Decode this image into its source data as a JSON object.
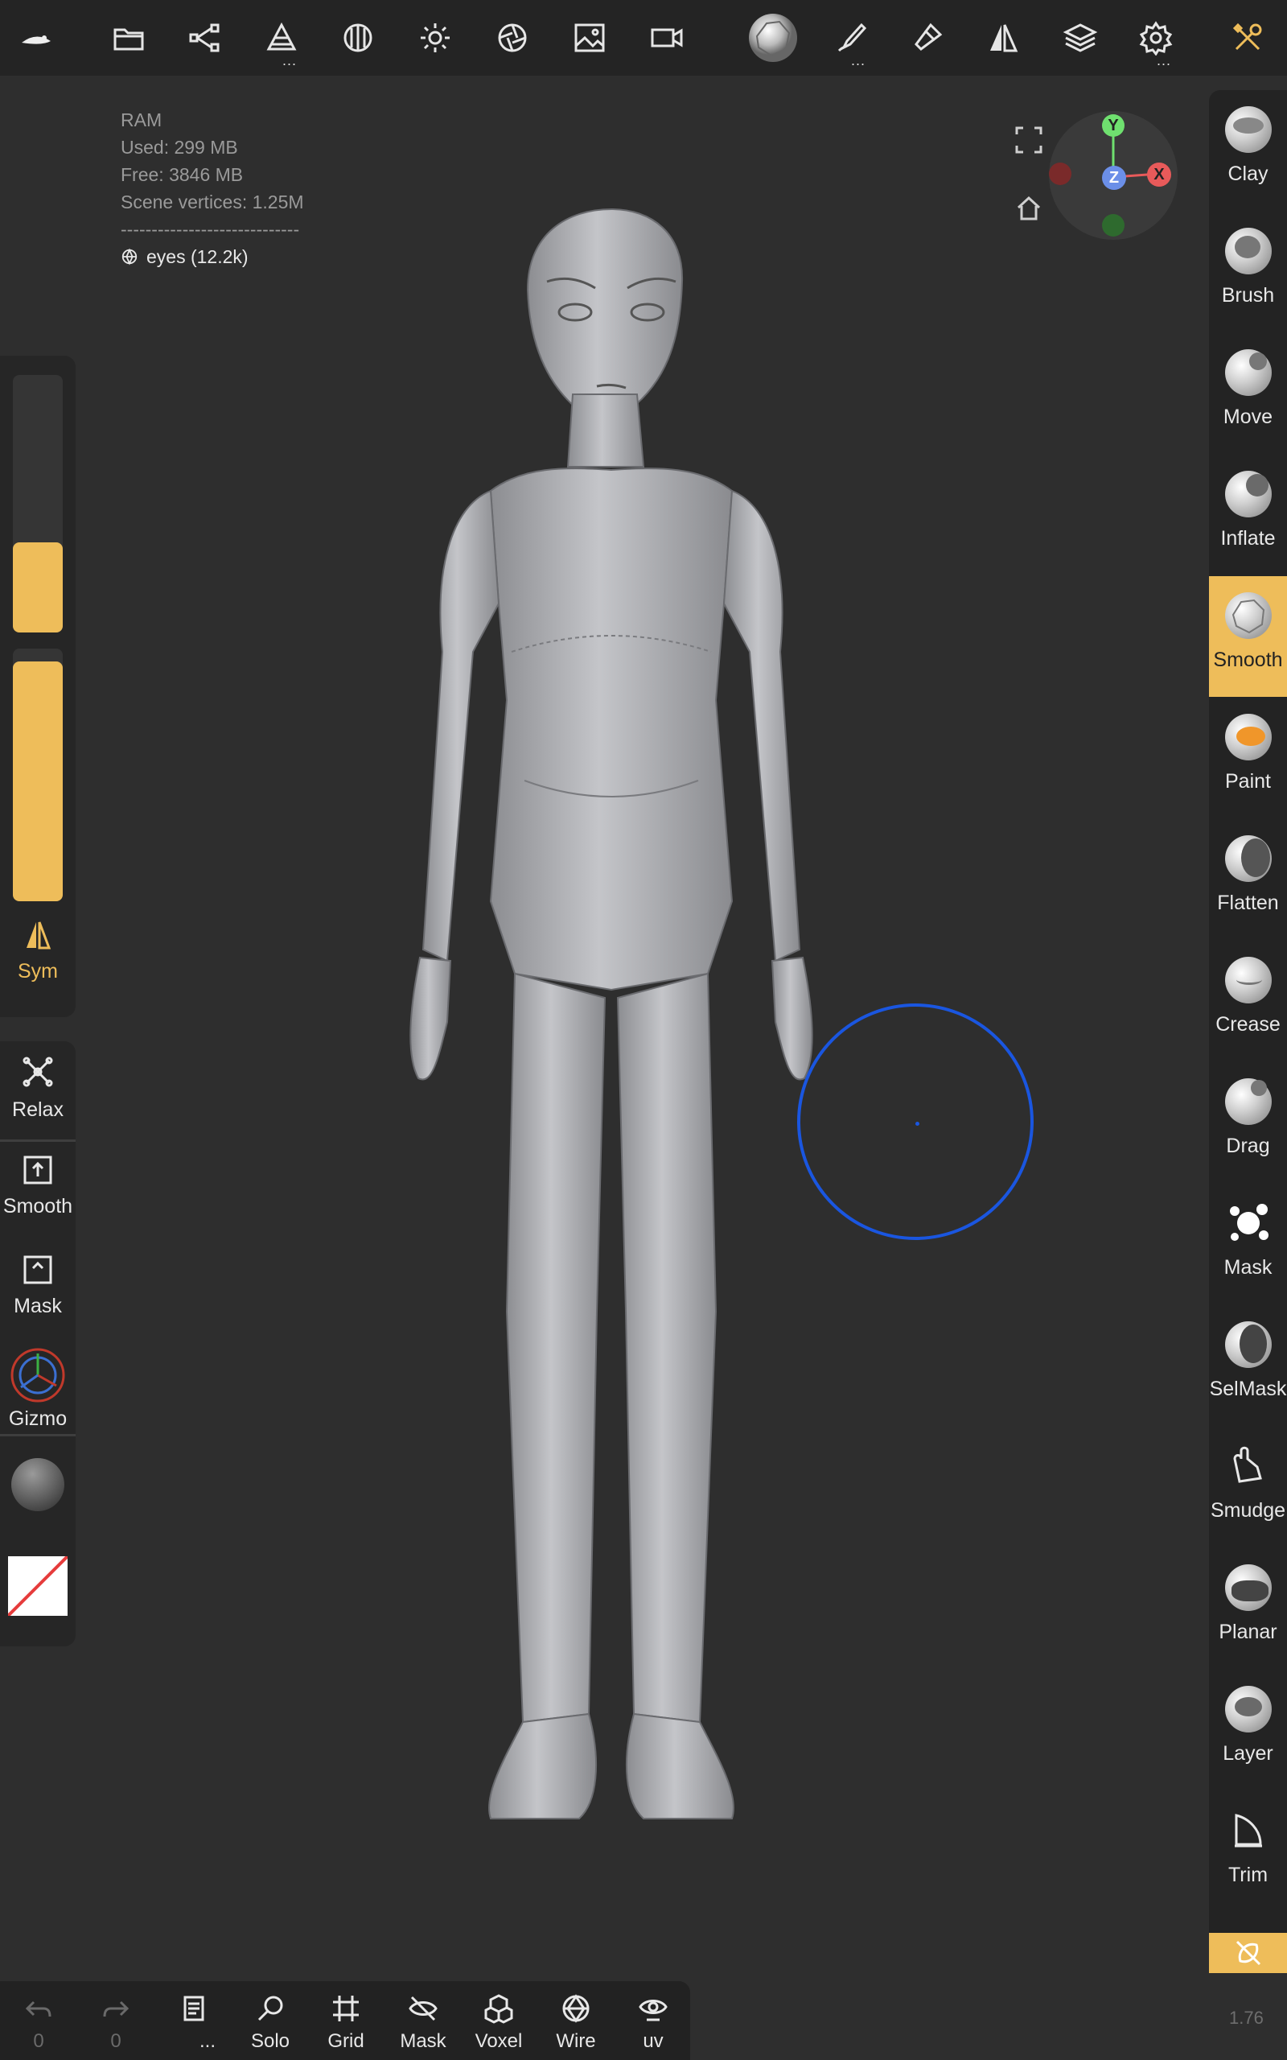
{
  "topbar": {
    "icons": [
      "logo-icon",
      "folder-icon",
      "scene-graph-icon",
      "primitives-icon",
      "material-sphere-icon",
      "light-icon",
      "camera-aperture-icon",
      "background-image-icon",
      "video-icon",
      "smooth-brush-ball-icon",
      "brush-settings-icon",
      "paint-brush-icon",
      "symmetry-icon",
      "layers-icon",
      "settings-icon",
      "tools-icon"
    ],
    "more_label": "..."
  },
  "ram": {
    "title": "RAM",
    "used": "Used: 299 MB",
    "free": "Free: 3846 MB",
    "vertices": "Scene vertices: 1.25M",
    "separator": "-----------------------------",
    "mesh": "eyes (12.2k)"
  },
  "left_panel": {
    "radius_level": 0.35,
    "intensity_level": 0.95,
    "sym_label": "Sym",
    "relax_label": "Relax",
    "smooth_label": "Smooth",
    "mask_label": "Mask",
    "gizmo_label": "Gizmo"
  },
  "tools": [
    {
      "label": "Clay"
    },
    {
      "label": "Brush"
    },
    {
      "label": "Move"
    },
    {
      "label": "Inflate"
    },
    {
      "label": "Smooth",
      "active": true
    },
    {
      "label": "Paint"
    },
    {
      "label": "Flatten"
    },
    {
      "label": "Crease"
    },
    {
      "label": "Drag"
    },
    {
      "label": "Mask"
    },
    {
      "label": "SelMask"
    },
    {
      "label": "Smudge"
    },
    {
      "label": "Planar"
    },
    {
      "label": "Layer"
    },
    {
      "label": "Trim"
    }
  ],
  "gizmo": {
    "y": "Y",
    "z": "Z",
    "x": "X",
    "colors": {
      "y": "#6fe06f",
      "x": "#e85a5a",
      "z": "#6b8fe8"
    }
  },
  "bottombar": {
    "undo_count": "0",
    "redo_count": "0",
    "more_label": "...",
    "solo_label": "Solo",
    "grid_label": "Grid",
    "mask_label": "Mask",
    "voxel_label": "Voxel",
    "wire_label": "Wire",
    "uv_label": "uv"
  },
  "version": "1.76",
  "colors": {
    "accent": "#eebd5a",
    "brush_circle": "#1a56e0"
  }
}
